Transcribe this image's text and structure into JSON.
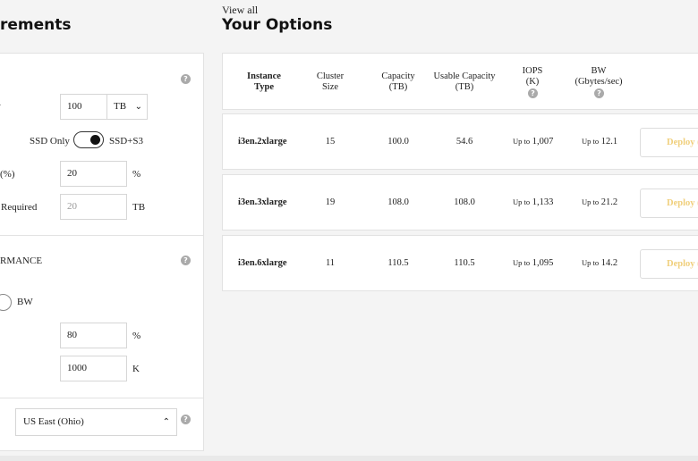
{
  "headers": {
    "left_title": "rements",
    "view_all": "View all",
    "right_title": "Your Options"
  },
  "capacity": {
    "row1_label": "·",
    "capacity_value": "100",
    "capacity_unit": "TB",
    "storage_left": "SSD Only",
    "storage_right": "SSD+S3",
    "row3_label": "(%)",
    "row3_value": "20",
    "row3_unit": "%",
    "row4_label": "Required",
    "row4_value": "20",
    "row4_unit": "TB"
  },
  "performance": {
    "title": "RMANCE",
    "radio_label": "BW",
    "field1_value": "80",
    "field1_unit": "%",
    "field2_value": "1000",
    "field2_unit": "K"
  },
  "region": {
    "value": "US East (Ohio)"
  },
  "help_glyph": "?",
  "table": {
    "columns": [
      {
        "line1": "Instance",
        "line2": "Type"
      },
      {
        "line1": "Cluster",
        "line2": "Size"
      },
      {
        "line1": "Capacity",
        "line2": "(TB)"
      },
      {
        "line1": "Usable Capacity",
        "line2": "(TB)"
      },
      {
        "line1": "IOPS",
        "line2": "(K)"
      },
      {
        "line1": "BW",
        "line2": "(Gbytes/sec)"
      }
    ],
    "up_to": "Up to",
    "deploy_label": "Deploy (",
    "rows": [
      {
        "instance": "i3en.2xlarge",
        "cluster": "15",
        "capacity": "100.0",
        "usable": "54.6",
        "iops": "1,007",
        "bw": "12.1"
      },
      {
        "instance": "i3en.3xlarge",
        "cluster": "19",
        "capacity": "108.0",
        "usable": "108.0",
        "iops": "1,133",
        "bw": "21.2"
      },
      {
        "instance": "i3en.6xlarge",
        "cluster": "11",
        "capacity": "110.5",
        "usable": "110.5",
        "iops": "1,095",
        "bw": "14.2"
      }
    ]
  },
  "colors": {
    "deploy_text": "#f0cf7c",
    "help_bg": "#aaaaaa"
  }
}
